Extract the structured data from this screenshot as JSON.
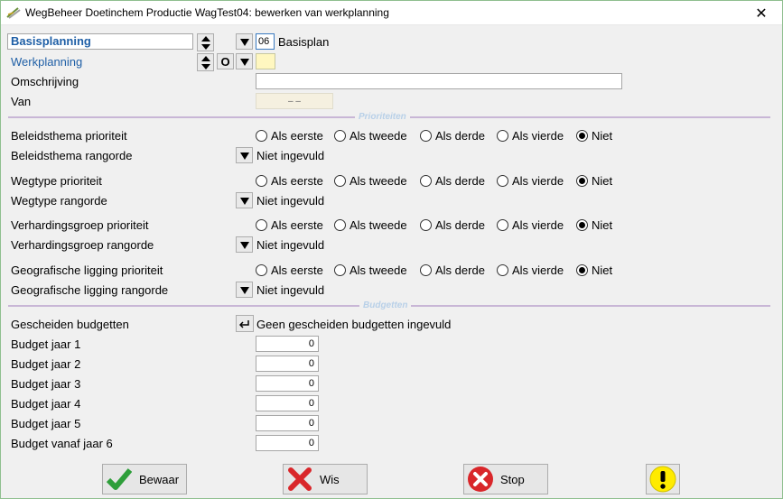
{
  "window": {
    "title": "WegBeheer Doetinchem Productie WagTest04: bewerken van werkplanning",
    "close_glyph": "✕"
  },
  "form": {
    "basisplanning_label": "Basisplanning",
    "basisplan_code": "06",
    "basisplan_name": "Basisplan",
    "werkplanning_label": "Werkplanning",
    "werkplanning_o": "O",
    "omschrijving_label": "Omschrijving",
    "omschrijving_value": "",
    "van_label": "Van",
    "van_value": "–   –"
  },
  "prioriteiten": {
    "section_label": "Prioriteiten",
    "options": [
      "Als eerste",
      "Als tweede",
      "Als derde",
      "Als vierde",
      "Niet"
    ],
    "selected": "Niet",
    "rows": [
      {
        "prio_label": "Beleidsthema prioriteit",
        "rang_label": "Beleidsthema rangorde",
        "rang_value": "Niet ingevuld"
      },
      {
        "prio_label": "Wegtype prioriteit",
        "rang_label": "Wegtype rangorde",
        "rang_value": "Niet ingevuld"
      },
      {
        "prio_label": "Verhardingsgroep prioriteit",
        "rang_label": "Verhardingsgroep rangorde",
        "rang_value": "Niet ingevuld"
      },
      {
        "prio_label": "Geografische ligging prioriteit",
        "rang_label": "Geografische ligging rangorde",
        "rang_value": "Niet ingevuld"
      }
    ]
  },
  "budgetten": {
    "section_label": "Budgetten",
    "gescheiden_label": "Gescheiden budgetten",
    "gescheiden_value": "Geen gescheiden budgetten ingevuld",
    "years": [
      {
        "label": "Budget jaar 1",
        "value": "0"
      },
      {
        "label": "Budget jaar 2",
        "value": "0"
      },
      {
        "label": "Budget jaar 3",
        "value": "0"
      },
      {
        "label": "Budget jaar 4",
        "value": "0"
      },
      {
        "label": "Budget jaar 5",
        "value": "0"
      },
      {
        "label": "Budget vanaf jaar 6",
        "value": "0"
      }
    ]
  },
  "buttons": {
    "bewaar": "Bewaar",
    "wis": "Wis",
    "stop": "Stop"
  },
  "colors": {
    "accent_blue": "#1f5fa6",
    "separator": "#c8b6d6",
    "ok_green": "#2e9e3a",
    "cancel_red": "#d9262a",
    "warn_yellow": "#ffeb00"
  }
}
